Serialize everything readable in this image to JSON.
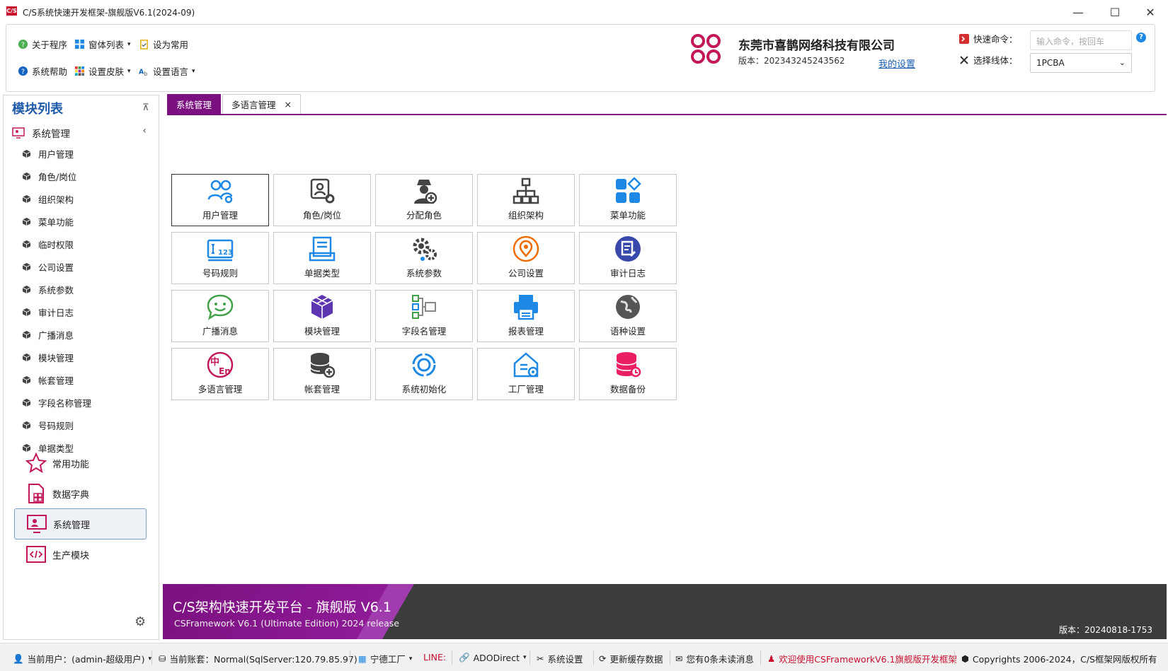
{
  "window": {
    "title": "C/S系统快速开发框架-旗舰版V6.1(2024-09)",
    "logo_text": "C/S",
    "minimize_glyph": "—",
    "maximize_glyph": "☐",
    "close_glyph": "✕"
  },
  "toolbar": {
    "about": "关于程序",
    "window_list": "窗体列表",
    "set_common": "设为常用",
    "system_help": "系统帮助",
    "set_skin": "设置皮肤",
    "set_language": "设置语言"
  },
  "company": {
    "name": "东莞市喜鹊网络科技有限公司",
    "version": "版本：202343245243562",
    "my_settings": "我的设置"
  },
  "quick": {
    "command_label": "快速命令：",
    "command_placeholder": "输入命令，按回车",
    "help": "?",
    "line_label": "选择线体：",
    "line_value": "1PCBA"
  },
  "sidebar": {
    "title": "模块列表",
    "group": "系统管理",
    "items": [
      "用户管理",
      "角色/岗位",
      "组织架构",
      "菜单功能",
      "临时权限",
      "公司设置",
      "系统参数",
      "审计日志",
      "广播消息",
      "模块管理",
      "帐套管理",
      "字段名称管理",
      "号码规则",
      "单据类型"
    ],
    "nav": [
      "常用功能",
      "数据字典",
      "系统管理",
      "生产模块"
    ]
  },
  "tabs": [
    {
      "label": "系统管理"
    },
    {
      "label": "多语言管理",
      "close": "×"
    }
  ],
  "tiles": [
    "用户管理",
    "角色/岗位",
    "分配角色",
    "组织架构",
    "菜单功能",
    "号码规则",
    "单据类型",
    "系统参数",
    "公司设置",
    "审计日志",
    "广播消息",
    "模块管理",
    "字段名管理",
    "报表管理",
    "语种设置",
    "多语言管理",
    "帐套管理",
    "系统初始化",
    "工厂管理",
    "数据备份"
  ],
  "banner": {
    "title": "C/S架构快速开发平台 - 旗舰版 V6.1",
    "subtitle": "CSFramework V6.1 (Ultimate Edition) 2024 release",
    "version": "版本：20240818-1753"
  },
  "status": {
    "user": "当前用户：(admin-超级用户)",
    "account": "当前账套：Normal(SqlServer:120.79.85.97)",
    "factory": "宁德工厂",
    "line": "LINE:",
    "ado": "ADODirect",
    "sys_settings": "系统设置",
    "refresh_cache": "更新缓存数据",
    "messages": "您有0条未读消息",
    "welcome": "欢迎使用CSFrameworkV6.1旗舰版开发框架",
    "copyright": "Copyrights 2006-2024，C/S框架网版权所有"
  },
  "colors": {
    "accent": "#7b1180",
    "link": "#1a5fb4",
    "tile_blue": "#1e88e5",
    "brand": "#c8102e"
  }
}
